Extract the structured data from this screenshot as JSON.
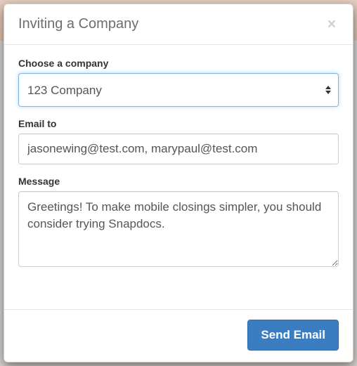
{
  "modal": {
    "title": "Inviting a Company",
    "close_label": "×"
  },
  "form": {
    "company": {
      "label": "Choose a company",
      "value": "123 Company"
    },
    "email": {
      "label": "Email to",
      "value": "jasonewing@test.com, marypaul@test.com"
    },
    "message": {
      "label": "Message",
      "value": "Greetings! To make mobile closings simpler, you should consider trying Snapdocs."
    }
  },
  "footer": {
    "send_label": "Send Email"
  }
}
